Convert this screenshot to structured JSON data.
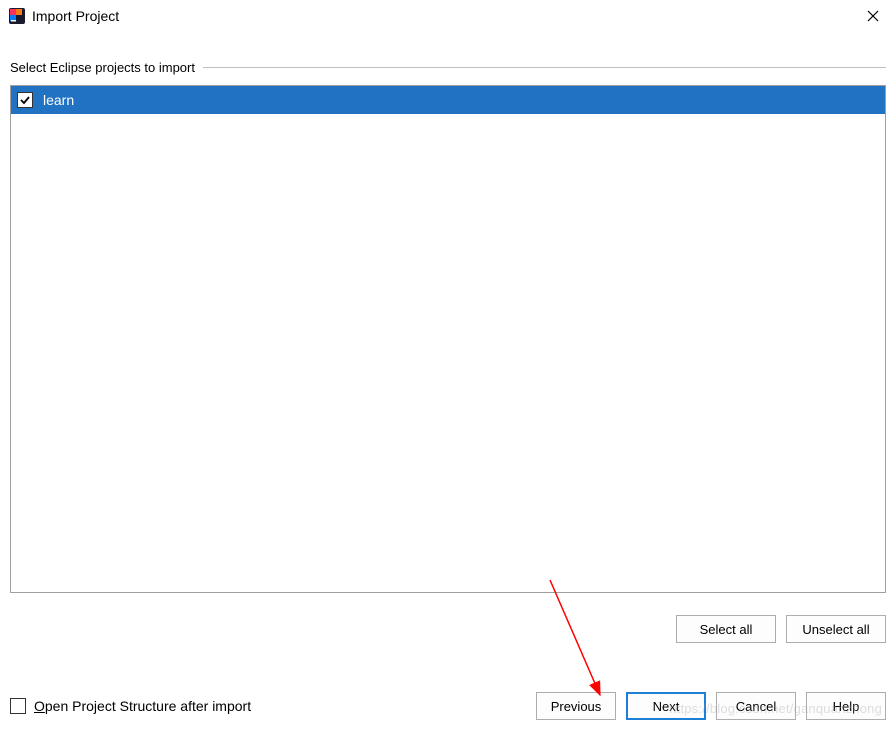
{
  "titlebar": {
    "title": "Import Project"
  },
  "section": {
    "label": "Select Eclipse projects to import"
  },
  "projects": [
    {
      "name": "learn",
      "checked": true,
      "selected": true
    }
  ],
  "buttons": {
    "select_all": "Select all",
    "unselect_all": "Unselect all",
    "previous": "Previous",
    "next": "Next",
    "cancel": "Cancel",
    "help": "Help"
  },
  "openStructure": {
    "mnemonic": "O",
    "rest": "pen Project Structure after import"
  },
  "watermark": "https://blog.csdn.net/ganquanzhong"
}
